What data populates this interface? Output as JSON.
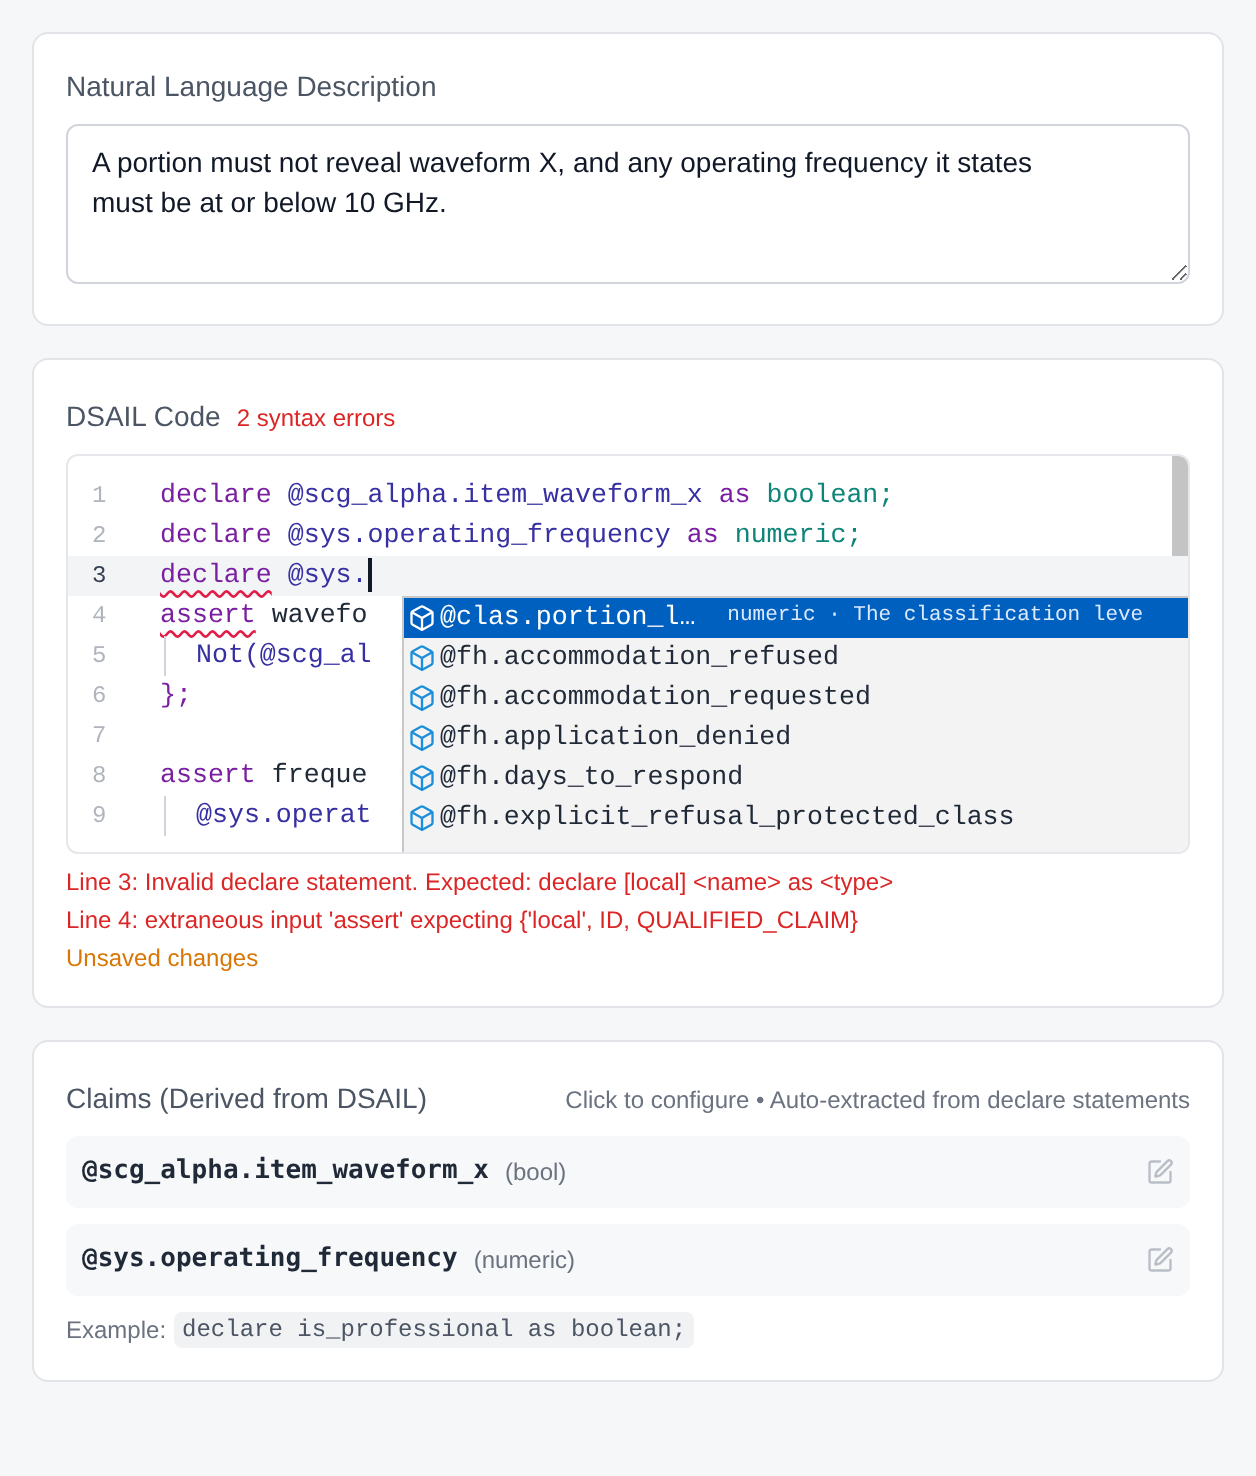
{
  "description": {
    "label": "Natural Language Description",
    "value": "A portion must not reveal waveform X, and any operating frequency it states must be at or below 10 GHz."
  },
  "code": {
    "label": "DSAIL Code",
    "error_count": "2 syntax errors",
    "lines": [
      {
        "number": "1",
        "current": false,
        "indented": false,
        "tokens": [
          {
            "kind": "keyword",
            "text": "declare",
            "error": false
          },
          {
            "kind": "name",
            "text": "@scg_alpha.item_waveform_x",
            "error": false
          },
          {
            "kind": "keyword",
            "text": "as",
            "error": false
          },
          {
            "kind": "type",
            "text": "boolean;",
            "error": false
          }
        ]
      },
      {
        "number": "2",
        "current": false,
        "indented": false,
        "tokens": [
          {
            "kind": "keyword",
            "text": "declare",
            "error": false
          },
          {
            "kind": "name",
            "text": "@sys.operating_frequency",
            "error": false
          },
          {
            "kind": "keyword",
            "text": "as",
            "error": false
          },
          {
            "kind": "type",
            "text": "numeric;",
            "error": false
          }
        ]
      },
      {
        "number": "3",
        "current": true,
        "indented": false,
        "tokens": [
          {
            "kind": "keyword",
            "text": "declare",
            "error": true
          },
          {
            "kind": "name",
            "text": "@sys.",
            "error": false
          }
        ]
      },
      {
        "number": "4",
        "current": false,
        "indented": false,
        "tokens": [
          {
            "kind": "keyword",
            "text": "assert",
            "error": true
          },
          {
            "kind": "plain",
            "text": "wavefo",
            "error": false
          }
        ]
      },
      {
        "number": "5",
        "current": false,
        "indented": true,
        "tokens": [
          {
            "kind": "name",
            "text": "Not(@scg_al",
            "error": false
          }
        ]
      },
      {
        "number": "6",
        "current": false,
        "indented": false,
        "tokens": [
          {
            "kind": "keyword",
            "text": "};",
            "error": false
          }
        ]
      },
      {
        "number": "7",
        "current": false,
        "indented": false
      },
      {
        "number": "8",
        "current": false,
        "indented": false,
        "tokens": [
          {
            "kind": "keyword",
            "text": "assert",
            "error": false
          },
          {
            "kind": "plain",
            "text": "freque",
            "error": false
          }
        ]
      },
      {
        "number": "9",
        "current": false,
        "indented": true,
        "tokens": [
          {
            "kind": "name",
            "text": "@sys.operat",
            "error": false
          }
        ]
      }
    ],
    "suggestions": [
      {
        "label": "@clas.portion_l…",
        "detail": "numeric · The classification leve",
        "selected": true
      },
      {
        "label": "@fh.accommodation_refused",
        "selected": false
      },
      {
        "label": "@fh.accommodation_requested",
        "selected": false
      },
      {
        "label": "@fh.application_denied",
        "selected": false
      },
      {
        "label": "@fh.days_to_respond",
        "selected": false
      },
      {
        "label": "@fh.explicit_refusal_protected_class",
        "selected": false
      }
    ],
    "errors": [
      "Line 3: Invalid declare statement. Expected: declare [local] <name> as <type>",
      "Line 4: extraneous input 'assert' expecting {'local', ID, QUALIFIED_CLAIM}"
    ],
    "status": "Unsaved changes"
  },
  "claims": {
    "title": "Claims (Derived from DSAIL)",
    "hint": "Click to configure • Auto-extracted from declare statements",
    "items": [
      {
        "name": "@scg_alpha.item_waveform_x",
        "type": "(bool)"
      },
      {
        "name": "@sys.operating_frequency",
        "type": "(numeric)"
      }
    ],
    "example_label": "Example:",
    "example_code": "declare is_professional as boolean;"
  }
}
